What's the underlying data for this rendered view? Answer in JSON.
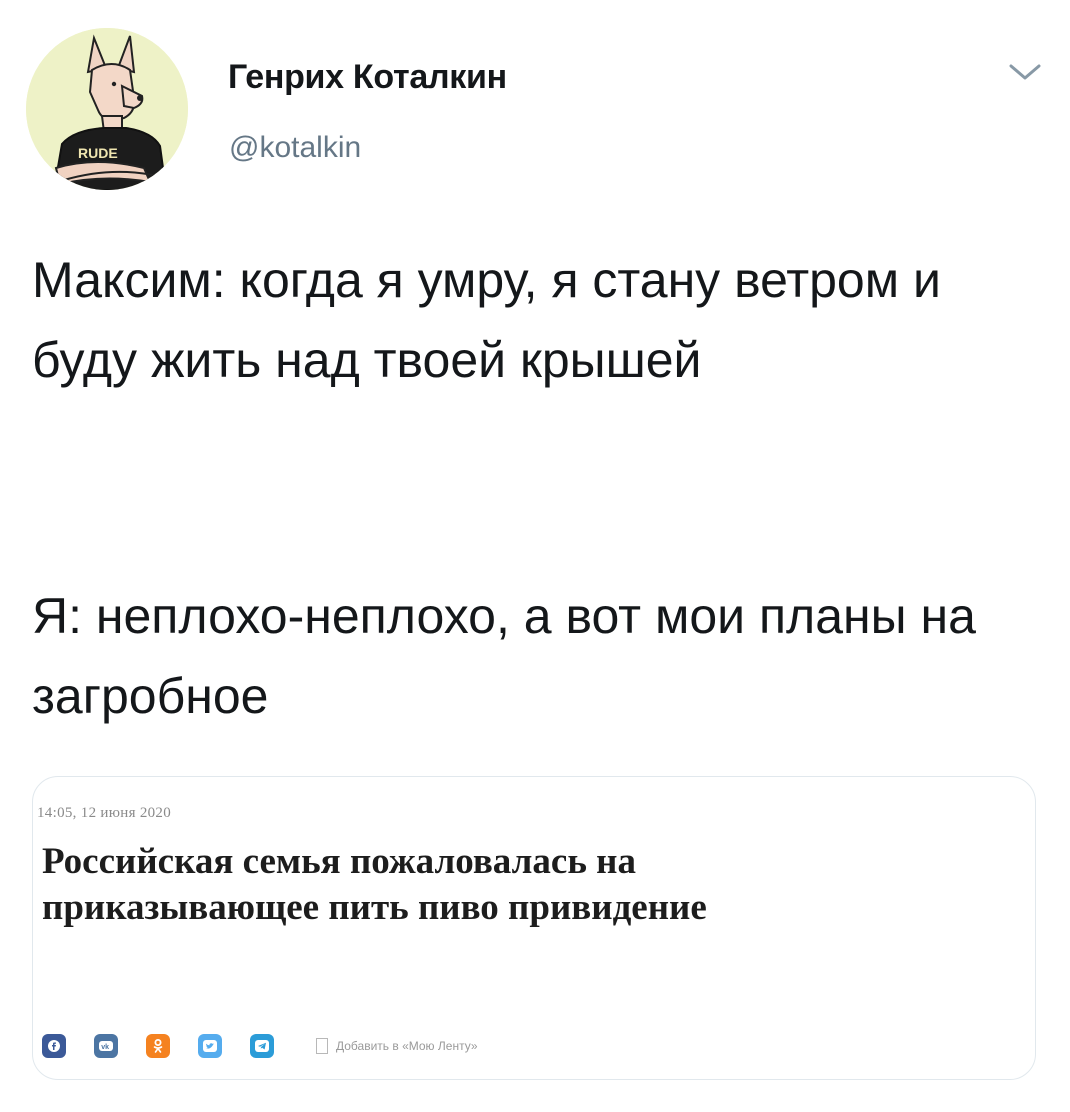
{
  "user": {
    "name": "Генрих Коталкин",
    "handle": "@kotalkin",
    "avatar_shirt_text": "RUDE"
  },
  "tweet": {
    "paragraph_1": "Максим: когда я умру, я стану ветром и буду жить над твоей крышей",
    "paragraph_2": "Я: неплохо-неплохо, а вот мои планы на загробное"
  },
  "card": {
    "date": "14:05, 12 июня 2020",
    "title": "Российская семья пожаловалась на приказывающее пить пиво привидение",
    "share_icons": [
      "facebook-icon",
      "vk-icon",
      "odnoklassniki-icon",
      "twitter-icon",
      "telegram-icon"
    ],
    "share_colors": [
      "#3b5998",
      "#4c75a3",
      "#f58220",
      "#55acee",
      "#2b9cd8"
    ],
    "bookmark_label": "Добавить в «Мою Ленту»"
  },
  "colors": {
    "text": "#14171a",
    "secondary": "#657786",
    "border": "#e1e8ed"
  }
}
